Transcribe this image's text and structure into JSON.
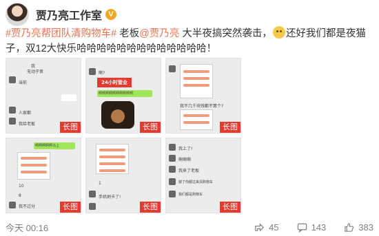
{
  "header": {
    "username": "贾乃亮工作室",
    "verified_badge_icon": "v-badge-icon"
  },
  "post": {
    "topic": "#贾乃亮帮团队清购物车#",
    "text1": " 老板",
    "mention": "@贾乃亮",
    "text2": " 大半夜搞突然袭击，",
    "emoji_icon": "doge-emoji-icon",
    "text3": "还好我们都是夜猫子，双12大快乐哈哈哈哈哈哈哈哈哈哈哈哈哈！"
  },
  "images": [
    {
      "badge": "长图",
      "texts": [
        "我",
        "无动于衷",
        "当前",
        "人家都",
        "我给老板"
      ]
    },
    {
      "badge": "长图",
      "texts": [
        "啊?",
        "24小时营业",
        "啊啊啊啊啊啊啊啊啊啊"
      ]
    },
    {
      "badge": "长图",
      "texts": [
        "我不几千块钱都不算个?"
      ]
    },
    {
      "badge": "长图",
      "texts": [
        "啊啊啊啊啊马上",
        "10",
        "8",
        "我不过分"
      ]
    },
    {
      "badge": "长图",
      "texts": [
        "1",
        "手机刷卡了!"
      ]
    },
    {
      "badge": "长图",
      "texts": [
        "我上了!",
        "啊啊啊",
        "我来了老板",
        "谢了你都过来清购物车",
        "我们都是购物车"
      ]
    }
  ],
  "footer": {
    "timestamp": "今天 00:16",
    "repost_count": "45",
    "comment_count": "143",
    "like_count": "383"
  },
  "colors": {
    "accent": "#eb7350",
    "badge_red": "#e8392f",
    "wechat_green": "#9fe658"
  }
}
